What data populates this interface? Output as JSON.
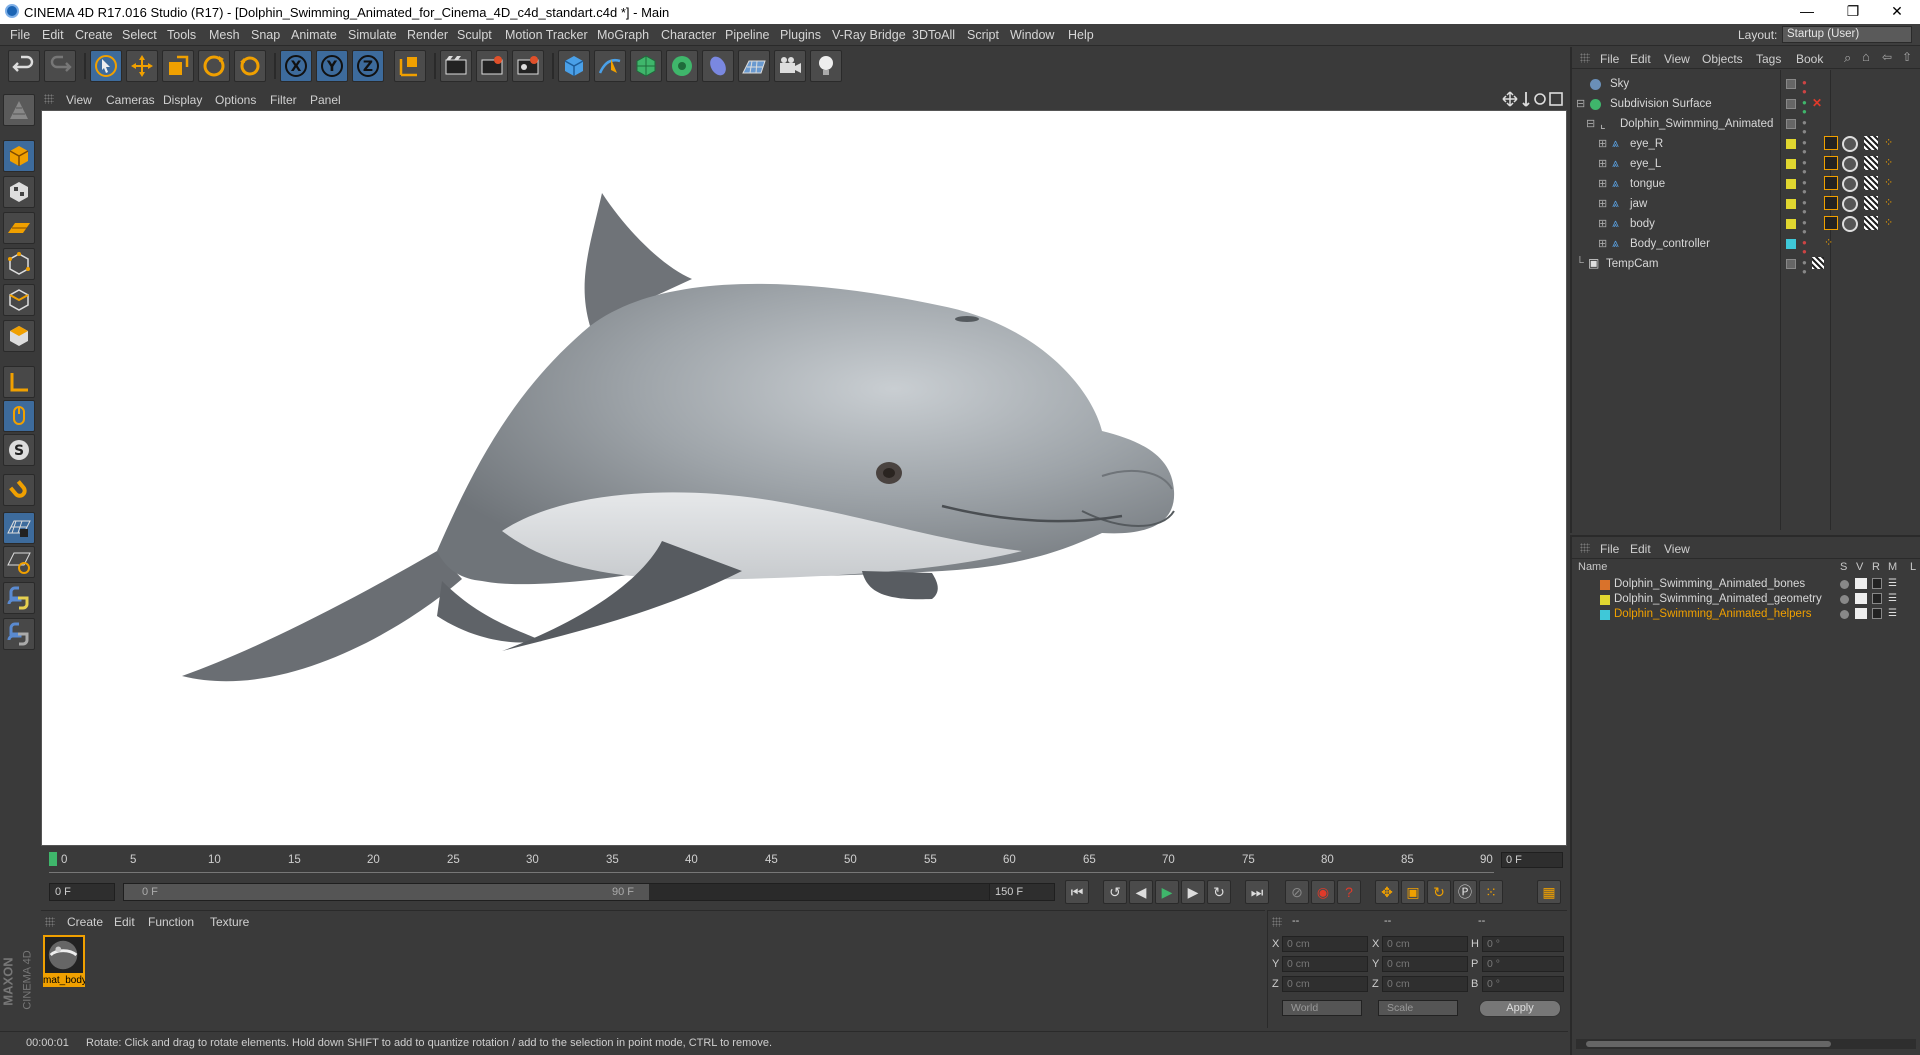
{
  "window": {
    "title": "CINEMA 4D R17.016 Studio (R17) - [Dolphin_Swimming_Animated_for_Cinema_4D_c4d_standart.c4d *] - Main",
    "minimize": "—",
    "restore": "❐",
    "close": "✕"
  },
  "menubar": {
    "items": [
      "File",
      "Edit",
      "Create",
      "Select",
      "Tools",
      "Mesh",
      "Snap",
      "Animate",
      "Simulate",
      "Render",
      "Sculpt",
      "Motion Tracker",
      "MoGraph",
      "Character",
      "Pipeline",
      "Plugins",
      "V-Ray Bridge",
      "3DToAll",
      "Script",
      "Window",
      "Help"
    ],
    "layout_label": "Layout:",
    "layout_value": "Startup (User)"
  },
  "toolbar": {
    "icons": [
      "undo-icon",
      "redo-icon",
      "live-selection-icon",
      "move-icon",
      "scale-icon",
      "rotate-icon",
      "recent-tool-icon",
      "x-axis-icon",
      "y-axis-icon",
      "z-axis-icon",
      "coordinate-system-icon",
      "render-view-icon",
      "render-picture-viewer-icon",
      "edit-render-settings-icon",
      "cube-icon",
      "pen-spline-icon",
      "subdivision-icon",
      "cloner-icon",
      "deformer-icon",
      "floor-icon",
      "camera-icon",
      "light-icon"
    ],
    "axis_labels": [
      "X",
      "Y",
      "Z"
    ]
  },
  "viewport_menu": {
    "items": [
      "View",
      "Cameras",
      "Display",
      "Options",
      "Filter",
      "Panel"
    ]
  },
  "timeline": {
    "ticks": [
      "0",
      "5",
      "10",
      "15",
      "20",
      "25",
      "30",
      "35",
      "40",
      "45",
      "50",
      "55",
      "60",
      "65",
      "70",
      "75",
      "80",
      "85",
      "90"
    ],
    "current_frame": "0 F"
  },
  "transport": {
    "start_frame": "0 F",
    "range_start": "0 F",
    "range_end": "90 F",
    "end_frame": "150 F"
  },
  "material_panel": {
    "menu": [
      "Create",
      "Edit",
      "Function",
      "Texture"
    ],
    "material_name": "mat_body"
  },
  "branding": {
    "maxon": "MAXON",
    "cinema4d": "CINEMA 4D"
  },
  "coordinates": {
    "headers": [
      "--",
      "--",
      "--"
    ],
    "rows": [
      {
        "l1": "X",
        "v1": "0 cm",
        "l2": "X",
        "v2": "0 cm",
        "l3": "H",
        "v3": "0 °"
      },
      {
        "l1": "Y",
        "v1": "0 cm",
        "l2": "Y",
        "v2": "0 cm",
        "l3": "P",
        "v3": "0 °"
      },
      {
        "l1": "Z",
        "v1": "0 cm",
        "l2": "Z",
        "v2": "0 cm",
        "l3": "B",
        "v3": "0 °"
      }
    ],
    "mode1": "World",
    "mode2": "Scale",
    "apply": "Apply"
  },
  "status": {
    "time": "00:00:01",
    "message": "Rotate: Click and drag to rotate elements. Hold down SHIFT to add to quantize rotation / add to the selection in point mode, CTRL to remove."
  },
  "object_manager": {
    "menu": [
      "File",
      "Edit",
      "View",
      "Objects",
      "Tags",
      "Book"
    ],
    "objects": [
      {
        "name": "Sky",
        "tag_color": "",
        "icon_color": "#6a8fb8"
      },
      {
        "name": "Subdivision Surface",
        "tag_color": "",
        "icon_color": "#3fb66b"
      },
      {
        "name": "Dolphin_Swimming_Animated",
        "tag_color": "",
        "icon_color": "#bdbdbd"
      },
      {
        "name": "eye_R",
        "tag_color": "#e0d630",
        "icon_color": "#5aa0e0"
      },
      {
        "name": "eye_L",
        "tag_color": "#e0d630",
        "icon_color": "#5aa0e0"
      },
      {
        "name": "tongue",
        "tag_color": "#e0d630",
        "icon_color": "#5aa0e0"
      },
      {
        "name": "jaw",
        "tag_color": "#e0d630",
        "icon_color": "#5aa0e0"
      },
      {
        "name": "body",
        "tag_color": "#e0d630",
        "icon_color": "#5aa0e0"
      },
      {
        "name": "Body_controller",
        "tag_color": "#3fc8d8",
        "icon_color": "#5aa0e0"
      },
      {
        "name": "TempCam",
        "tag_color": "",
        "icon_color": "#bdbdbd"
      }
    ]
  },
  "layer_manager": {
    "menu": [
      "File",
      "Edit",
      "View"
    ],
    "columns": [
      "Name",
      "S",
      "V",
      "R",
      "M",
      "L"
    ],
    "layers": [
      {
        "name": "Dolphin_Swimming_Animated_bones",
        "color": "#d9722b",
        "text_color": "#d8d8d8"
      },
      {
        "name": "Dolphin_Swimming_Animated_geometry",
        "color": "#e0d630",
        "text_color": "#d8d8d8"
      },
      {
        "name": "Dolphin_Swimming_Animated_helpers",
        "color": "#3fc8d8",
        "text_color": "#f0a000"
      }
    ]
  }
}
